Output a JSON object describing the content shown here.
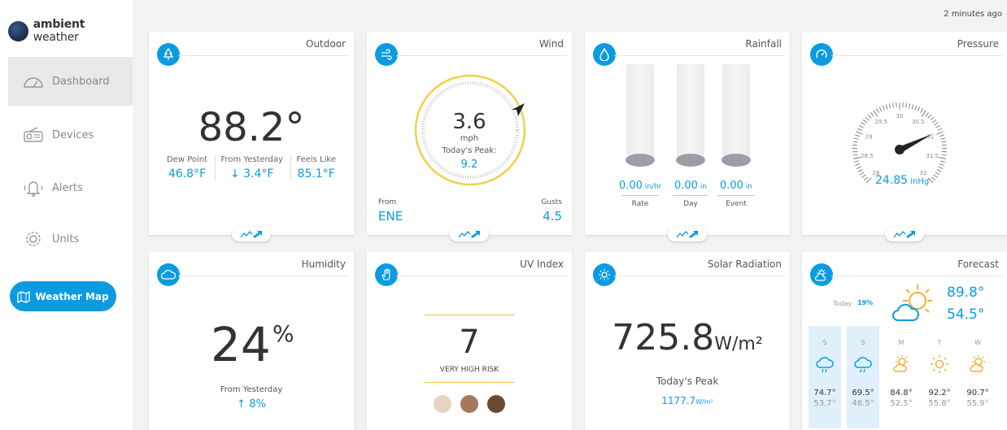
{
  "brand": {
    "name_bold": "ambient",
    "name_light": " weather"
  },
  "updated": "2 minutes ago",
  "nav": {
    "dashboard": "Dashboard",
    "devices": "Devices",
    "alerts": "Alerts",
    "units": "Units",
    "weather_map": "Weather Map"
  },
  "outdoor": {
    "title": "Outdoor",
    "temp": "88.2°",
    "dew_label": "Dew Point",
    "dew_value": "46.8°F",
    "from_yesterday_label": "From Yesterday",
    "from_yesterday_value": "↓  3.4°F",
    "feels_label": "Feels Like",
    "feels_value": "85.1°F"
  },
  "wind": {
    "title": "Wind",
    "speed": "3.6",
    "unit": "mph",
    "peak_label": "Today's Peak:",
    "peak_value": "9.2",
    "from_label": "From",
    "from_value": "ENE",
    "gusts_label": "Gusts",
    "gusts_value": "4.5"
  },
  "rainfall": {
    "title": "Rainfall",
    "items": [
      {
        "value": "0.00",
        "unit": " in/hr",
        "label": "Rate"
      },
      {
        "value": "0.00",
        "unit": " in",
        "label": "Day"
      },
      {
        "value": "0.00",
        "unit": " in",
        "label": "Event"
      }
    ]
  },
  "pressure": {
    "title": "Pressure",
    "value": "24.85",
    "unit": " inHg",
    "ticks": [
      "28",
      "28.5",
      "29",
      "29.5",
      "30",
      "30.5",
      "31",
      "31.5",
      "32"
    ]
  },
  "humidity": {
    "title": "Humidity",
    "value": "24",
    "percent": "%",
    "from_label": "From Yesterday",
    "from_value": "↑ 8%"
  },
  "uv": {
    "title": "UV Index",
    "value": "7",
    "risk": "VERY HIGH RISK",
    "skin_colors": [
      "#e6d4c0",
      "#a47a5a",
      "#6a4a32"
    ]
  },
  "solar": {
    "title": "Solar Radiation",
    "value": "725.8",
    "unit": "W/m²",
    "peak_label": "Today's Peak",
    "peak_value": "1177.7",
    "peak_unit": "W/m²"
  },
  "forecast": {
    "title": "Forecast",
    "today_label": "Today",
    "today_pop": "19%",
    "today_hi": "89.8°",
    "today_lo": "54.5°",
    "days": [
      {
        "name": "S",
        "icon": "rain-cloud-icon",
        "hi": "74.7°",
        "lo": "53.7°"
      },
      {
        "name": "S",
        "icon": "rain-cloud-icon",
        "hi": "69.5°",
        "lo": "48.5°"
      },
      {
        "name": "M",
        "icon": "partly-sunny-icon",
        "hi": "84.8°",
        "lo": "52.5°"
      },
      {
        "name": "T",
        "icon": "sun-icon",
        "hi": "92.2°",
        "lo": "55.8°"
      },
      {
        "name": "W",
        "icon": "partly-sunny-icon",
        "hi": "90.7°",
        "lo": "55.9°"
      }
    ]
  },
  "colors": {
    "accent": "#0b9be0",
    "gold": "#f0c040"
  }
}
